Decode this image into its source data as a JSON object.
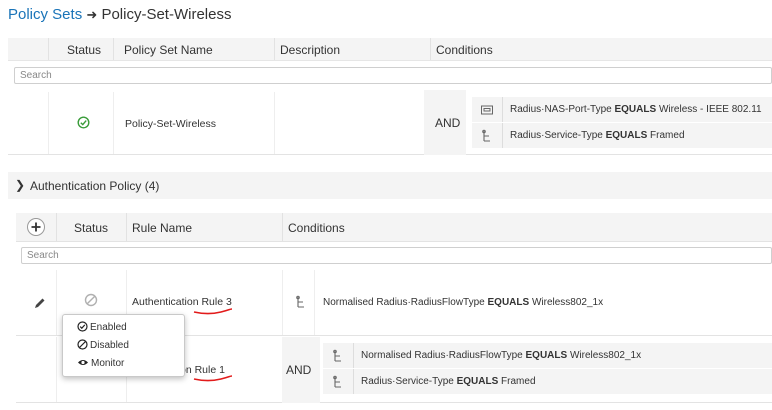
{
  "breadcrumb": {
    "parent": "Policy Sets",
    "current": "Policy-Set-Wireless"
  },
  "policy_table": {
    "columns": [
      "Status",
      "Policy Set Name",
      "Description",
      "Conditions"
    ],
    "search_placeholder": "Search",
    "row": {
      "name": "Policy-Set-Wireless",
      "description": "",
      "operator": "AND",
      "conditions": [
        {
          "icon": "network-port-icon",
          "attribute": "Radius·NAS-Port-Type",
          "op": "EQUALS",
          "value": "Wireless - IEEE 802.11"
        },
        {
          "icon": "condition-tree-icon",
          "attribute": "Radius·Service-Type",
          "op": "EQUALS",
          "value": "Framed"
        }
      ]
    }
  },
  "auth_policy": {
    "title": "Authentication Policy (4)",
    "columns": [
      "Status",
      "Rule Name",
      "Conditions"
    ],
    "search_placeholder": "Search",
    "rules": [
      {
        "name": "Authentication Rule 3",
        "status_icon": "disabled-icon",
        "condition": {
          "attribute": "Normalised Radius·RadiusFlowType",
          "op": "EQUALS",
          "value": "Wireless802_1x"
        }
      },
      {
        "name_visible": "on Rule 1",
        "operator": "AND",
        "conditions": [
          {
            "attribute": "Normalised Radius·RadiusFlowType",
            "op": "EQUALS",
            "value": "Wireless802_1x"
          },
          {
            "attribute": "Radius·Service-Type",
            "op": "EQUALS",
            "value": "Framed"
          }
        ]
      }
    ]
  },
  "status_menu": {
    "items": [
      "Enabled",
      "Disabled",
      "Monitor"
    ]
  },
  "colors": {
    "link": "#1a74b8",
    "enabled": "#3a9c3a",
    "annotation": "#e21b1b"
  }
}
